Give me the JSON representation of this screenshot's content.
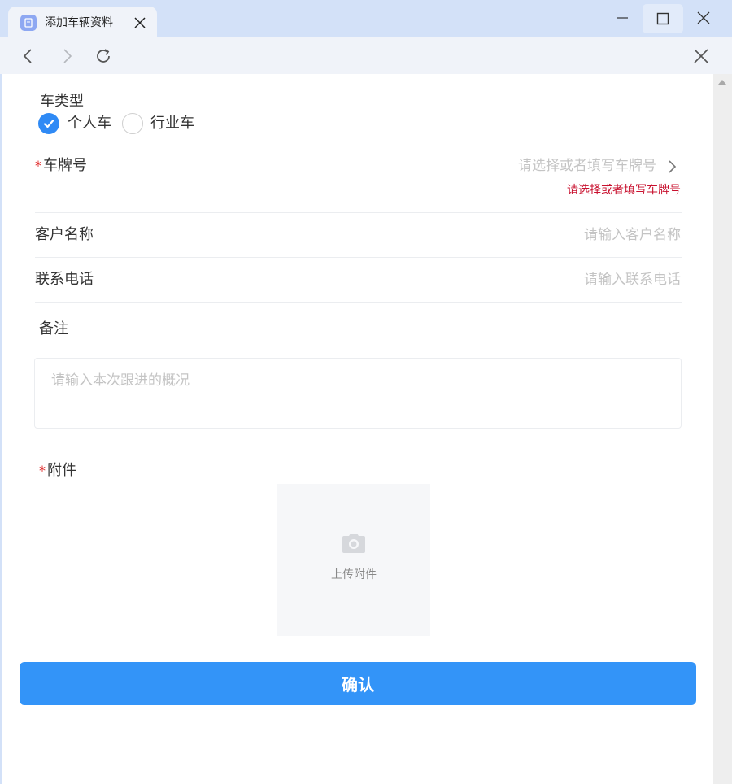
{
  "window": {
    "tab_title": "添加车辆资料"
  },
  "form": {
    "vehicle_type": {
      "label": "车类型",
      "options": [
        {
          "label": "个人车",
          "checked": true
        },
        {
          "label": "行业车",
          "checked": false
        }
      ]
    },
    "plate": {
      "required_mark": "*",
      "label": "车牌号",
      "placeholder": "请选择或者填写车牌号",
      "error": "请选择或者填写车牌号"
    },
    "customer_name": {
      "label": "客户名称",
      "placeholder": "请输入客户名称"
    },
    "phone": {
      "label": "联系电话",
      "placeholder": "请输入联系电话"
    },
    "remark": {
      "label": "备注",
      "placeholder": "请输入本次跟进的概况"
    },
    "attachment": {
      "required_mark": "*",
      "label": "附件",
      "upload_text": "上传附件"
    },
    "confirm_label": "确认"
  },
  "colors": {
    "accent": "#3394f8",
    "error": "#c8102e",
    "required": "#e02828",
    "placeholder": "#c4c4c4"
  },
  "icons": {
    "tab": "document-icon",
    "back": "chevron-left-icon",
    "forward": "chevron-right-icon",
    "reload": "reload-icon",
    "close": "close-icon",
    "plate_arrow": "chevron-right-icon",
    "upload": "camera-icon"
  }
}
